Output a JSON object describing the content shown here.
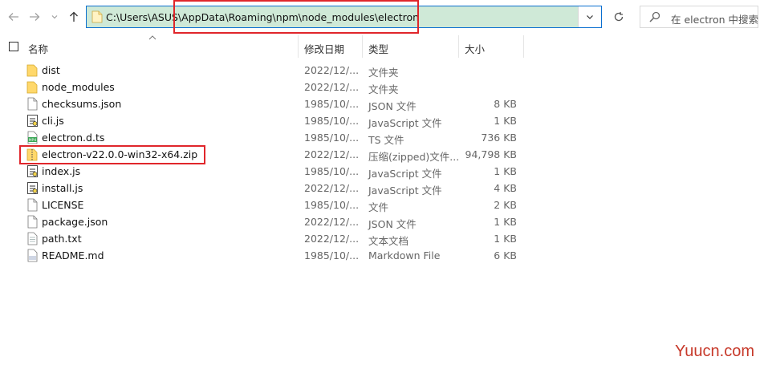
{
  "address_bar": {
    "path": "C:\\Users\\ASUS\\AppData\\Roaming\\npm\\node_modules\\electron",
    "search_placeholder": "在 electron 中搜索"
  },
  "columns": {
    "name": "名称",
    "date": "修改日期",
    "type": "类型",
    "size": "大小"
  },
  "files": [
    {
      "name": "dist",
      "date": "2022/12/...",
      "type": "文件夹",
      "size": "",
      "icon": "folder-icon"
    },
    {
      "name": "node_modules",
      "date": "2022/12/...",
      "type": "文件夹",
      "size": "",
      "icon": "folder-icon"
    },
    {
      "name": "checksums.json",
      "date": "1985/10/...",
      "type": "JSON 文件",
      "size": "8 KB",
      "icon": "document-icon"
    },
    {
      "name": "cli.js",
      "date": "1985/10/...",
      "type": "JavaScript 文件",
      "size": "1 KB",
      "icon": "script-icon"
    },
    {
      "name": "electron.d.ts",
      "date": "1985/10/...",
      "type": "TS 文件",
      "size": "736 KB",
      "icon": "ts-file-icon"
    },
    {
      "name": "electron-v22.0.0-win32-x64.zip",
      "date": "2022/12/...",
      "type": "压缩(zipped)文件...",
      "size": "94,798 KB",
      "icon": "zip-folder-icon"
    },
    {
      "name": "index.js",
      "date": "1985/10/...",
      "type": "JavaScript 文件",
      "size": "1 KB",
      "icon": "script-icon"
    },
    {
      "name": "install.js",
      "date": "2022/12/...",
      "type": "JavaScript 文件",
      "size": "4 KB",
      "icon": "script-icon"
    },
    {
      "name": "LICENSE",
      "date": "1985/10/...",
      "type": "文件",
      "size": "2 KB",
      "icon": "document-icon"
    },
    {
      "name": "package.json",
      "date": "2022/12/...",
      "type": "JSON 文件",
      "size": "1 KB",
      "icon": "document-icon"
    },
    {
      "name": "path.txt",
      "date": "2022/12/...",
      "type": "文本文档",
      "size": "1 KB",
      "icon": "text-document-icon"
    },
    {
      "name": "README.md",
      "date": "1985/10/...",
      "type": "Markdown File",
      "size": "6 KB",
      "icon": "markdown-file-icon"
    }
  ],
  "watermark": "Yuucn.com",
  "highlight_color": "#e0262b",
  "address_bg": "#cfe9d7"
}
